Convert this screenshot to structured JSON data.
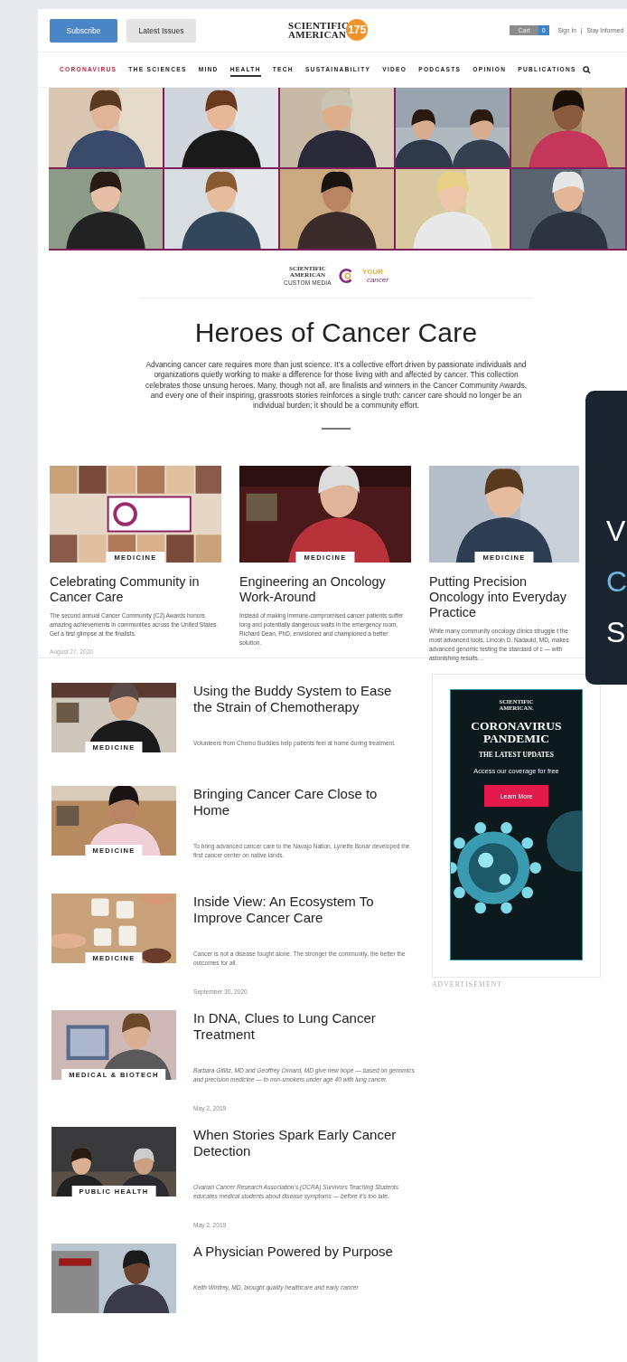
{
  "header": {
    "buttons": [
      {
        "label": "Subscribe",
        "kind": "primary"
      },
      {
        "label": "Latest Issues",
        "kind": "secondary"
      }
    ],
    "logo": {
      "line1": "SCIENTIFIC",
      "line2": "AMERICAN",
      "badge": "175"
    },
    "cart": {
      "label": "Cart",
      "count": "0"
    },
    "links": [
      "Sign In",
      "Stay Informed"
    ],
    "separator": "|"
  },
  "nav": [
    {
      "label": "CORONAVIRUS",
      "kind": "alert",
      "selected": false
    },
    {
      "label": "THE SCIENCES",
      "kind": "section",
      "selected": false
    },
    {
      "label": "MIND",
      "kind": "section",
      "selected": false
    },
    {
      "label": "HEALTH",
      "kind": "section",
      "selected": true
    },
    {
      "label": "TECH",
      "kind": "section",
      "selected": false
    },
    {
      "label": "SUSTAINABILITY",
      "kind": "section",
      "selected": false
    },
    {
      "label": "VIDEO",
      "kind": "section",
      "selected": false
    },
    {
      "label": "PODCASTS",
      "kind": "section",
      "selected": false
    },
    {
      "label": "OPINION",
      "kind": "section",
      "selected": false
    },
    {
      "label": "PUBLICATIONS",
      "kind": "section",
      "selected": false
    }
  ],
  "partners": {
    "sa_line1": "SCIENTIFIC",
    "sa_line2": "AMERICAN",
    "sa_sub": "CUSTOM MEDIA",
    "your": "YOUR",
    "cancer": "cancer"
  },
  "title": "Heroes of Cancer Care",
  "intro": "Advancing cancer care requires more than just science. It’s a collective effort driven by passionate individuals and organizations quietly working to make a difference for those living with and affected by cancer. This collection celebrates those unsung heroes. Many, though not all, are finalists and winners in the Cancer Community Awards, and every one of their inspiring, grassroots stories reinforces a single truth: cancer care should no longer be an individual burden; it should be a community effort.",
  "cards": [
    {
      "tag": "MEDICINE",
      "title": "Celebrating Community in Cancer Care",
      "summary": "The second annual Cancer Community (C2) Awards honors amazing achievements in communities across the United States. Get a first glimpse at the finalists.",
      "date": "August 27, 2020"
    },
    {
      "tag": "MEDICINE",
      "title": "Engineering an Oncology Work-Around",
      "summary": "Instead of making immune-compromised cancer patients suffer long and potentially dangerous waits in the emergency room, Richard Dean, PhD, envisioned and championed a better solution."
    },
    {
      "tag": "MEDICINE",
      "title": "Putting Precision Oncology into Everyday Practice",
      "summary": "While many community oncology clinics struggle t the most advanced tools, Lincoln D. Nadauld, MD, makes advanced genomic testing the standard of c — with astonishing results…"
    }
  ],
  "stories": [
    {
      "tag": "MEDICINE",
      "title": "Using the Buddy System to Ease the Strain of Chemotherapy",
      "summary": "Volunteers from Chemo Buddies help patients feel at home during treatment.",
      "italic": false
    },
    {
      "tag": "MEDICINE",
      "title": "Bringing Cancer Care Close to Home",
      "summary": "To bring advanced cancer care to the Navajo Nation, Lynette Bonar developed the first cancer center on native lands.",
      "italic": false
    },
    {
      "tag": "MEDICINE",
      "title": "Inside View: An Ecosystem To Improve Cancer Care",
      "summary": "Cancer is not a disease fought alone. The stronger the community, the better the outcomes for all.",
      "italic": false,
      "date": "September 30, 2020"
    },
    {
      "tag": "MEDICAL & BIOTECH",
      "title": "In DNA, Clues to Lung Cancer Treatment",
      "summary": "Barbara Gitlitz, MD and Geoffrey Oxnard, MD give new hope — based on genomics and precision medicine — to non-smokers under age 40 with lung cancer.",
      "italic": true,
      "date": "May 2, 2019"
    },
    {
      "tag": "PUBLIC HEALTH",
      "title": "When Stories Spark Early Cancer Detection",
      "summary": "Ovarian Cancer Research Association’s (OCRA) Survivors Teaching Students educates medical students about disease symptoms — before it’s too late.",
      "italic": true,
      "date": "May 2, 2019"
    },
    {
      "title": "A Physician Powered by Purpose",
      "summary": "Keith Winfrey, MD, brought quality healthcare and early cancer",
      "italic": true
    }
  ],
  "ad": {
    "brand1": "SCIENTIFIC",
    "brand2": "AMERICAN.",
    "headline1": "CORONAVIRUS",
    "headline2": "PANDEMIC",
    "subhead": "THE LATEST UPDATES",
    "text": "Access our coverage for free",
    "button": "Learn More",
    "label": "ADVERTISEMENT"
  },
  "popup": {
    "letters": [
      {
        "text": "V",
        "kind": "plain"
      },
      {
        "text": "C",
        "kind": "accent"
      },
      {
        "text": "S",
        "kind": "plain"
      }
    ]
  }
}
